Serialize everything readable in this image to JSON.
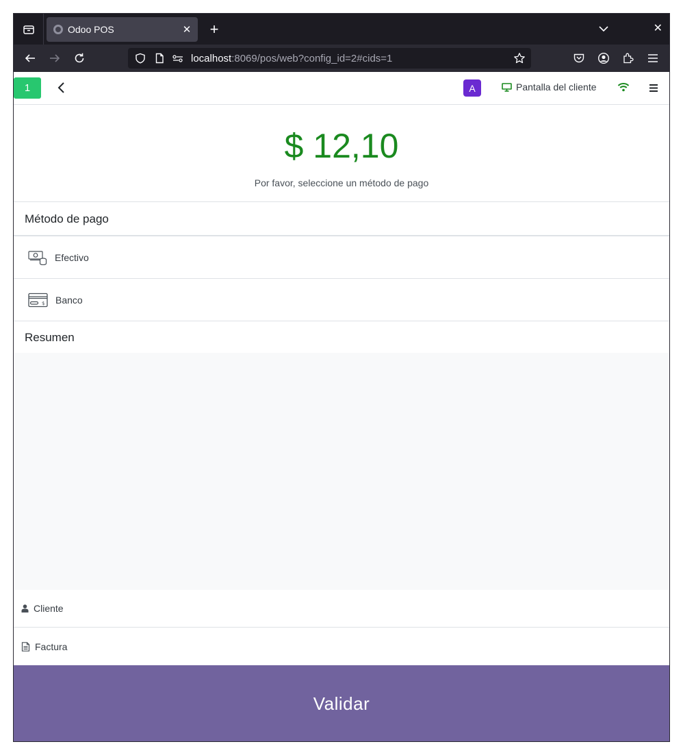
{
  "browser": {
    "tab_title": "Odoo POS",
    "url_host": "localhost",
    "url_rest": ":8069/pos/web?config_id=2#cids=1"
  },
  "header": {
    "order_number": "1",
    "user_initial": "A",
    "customer_display_label": "Pantalla del cliente"
  },
  "payment": {
    "amount": "$ 12,10",
    "hint": "Por favor, seleccione un método de pago",
    "methods_title": "Método de pago",
    "methods": [
      {
        "label": "Efectivo",
        "icon": "cash-icon"
      },
      {
        "label": "Banco",
        "icon": "bank-card-icon"
      }
    ],
    "summary_title": "Resumen"
  },
  "footer": {
    "customer_label": "Cliente",
    "invoice_label": "Factura",
    "validate_label": "Validar"
  },
  "colors": {
    "amount": "#1a8a1f",
    "validate_bg": "#71639e",
    "order_badge": "#28c76f",
    "avatar": "#6a2ad1"
  }
}
